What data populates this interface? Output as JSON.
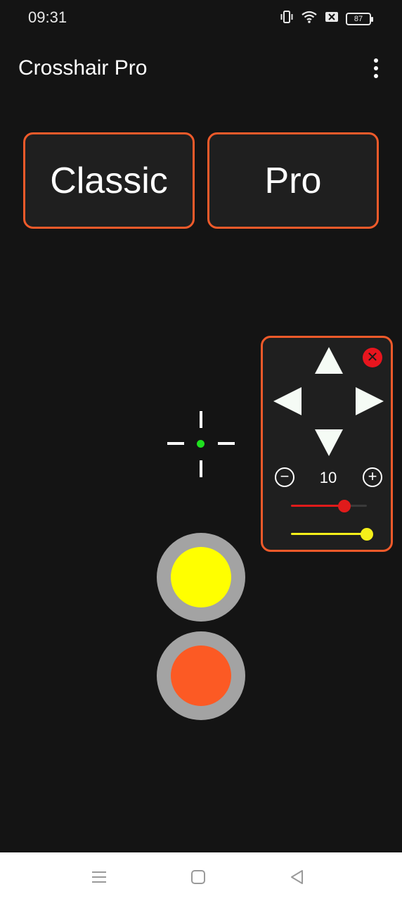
{
  "status_bar": {
    "time": "09:31",
    "battery_level": "87",
    "icons": [
      "vibrate-icon",
      "wifi-icon",
      "no-sim-icon",
      "battery-icon"
    ]
  },
  "app_bar": {
    "title": "Crosshair Pro",
    "menu_icon": "more-vert-icon"
  },
  "mode_buttons": {
    "classic_label": "Classic",
    "pro_label": "Pro"
  },
  "crosshair": {
    "dot_color": "#1fe01f",
    "line_color": "#ffffff"
  },
  "control_panel": {
    "border_color": "#f05a2a",
    "step_value": "10",
    "arrows": [
      "up-arrow-icon",
      "down-arrow-icon",
      "left-arrow-icon",
      "right-arrow-icon"
    ],
    "close_icon": "close-icon",
    "red_slider": {
      "color": "#e01b1b",
      "level": 0.7
    },
    "yellow_slider": {
      "color": "#f5ef1a",
      "level": 1.0
    }
  },
  "round_buttons": {
    "yellow": {
      "color": "#ffff00"
    },
    "orange": {
      "color": "#fc5a24"
    }
  },
  "nav_bar": {
    "icons": [
      "menu-icon",
      "home-icon",
      "back-icon"
    ]
  }
}
